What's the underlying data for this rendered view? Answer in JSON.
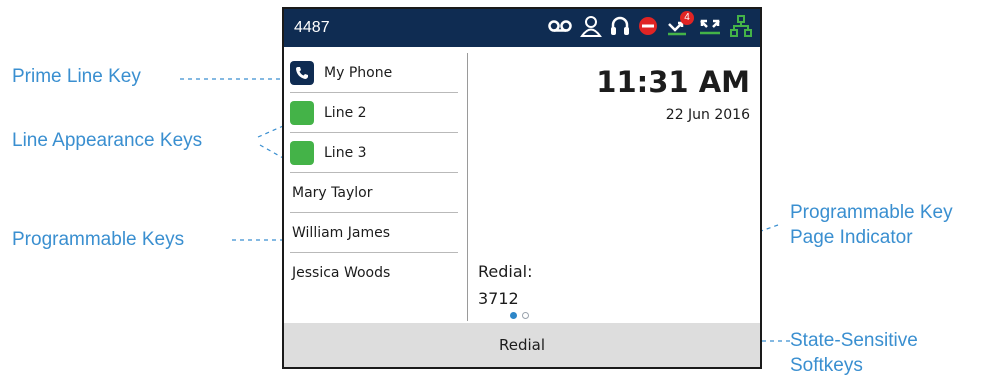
{
  "callouts": {
    "prime_line_key": "Prime Line Key",
    "line_appearance_keys": "Line Appearance Keys",
    "programmable_keys": "Programmable Keys",
    "page_indicator_line1": "Programmable Key",
    "page_indicator_line2": "Page Indicator",
    "softkeys_line1": "State-Sensitive",
    "softkeys_line2": "Softkeys"
  },
  "phone": {
    "extension": "4487",
    "status_icons": [
      "voicemail-icon",
      "directory-icon",
      "headset-icon",
      "do-not-disturb-icon",
      "missed-calls-icon",
      "call-history-icon",
      "network-icon"
    ],
    "missed_calls_badge": "4",
    "line_keys": [
      {
        "label": "My Phone",
        "icon": "phone-icon",
        "color": "#0f2c52"
      },
      {
        "label": "Line 2",
        "icon": "line-status",
        "color": "#44b348"
      },
      {
        "label": "Line 3",
        "icon": "line-status",
        "color": "#44b348"
      }
    ],
    "programmable_keys": [
      "Mary Taylor",
      "William James",
      "Jessica Woods"
    ],
    "time": "11:31 AM",
    "date": "22 Jun 2016",
    "redial_label": "Redial:",
    "redial_number": "3712",
    "page_indicator": {
      "current_page": 1,
      "total_pages": 2
    },
    "softkey": "Redial"
  },
  "colors": {
    "status_bar": "#0f2c52",
    "callout_text": "#3a8fd0",
    "line_active": "#44b348",
    "dnd_red": "#e02424",
    "network_green": "#44b348",
    "softkey_bar": "#dddddd"
  }
}
